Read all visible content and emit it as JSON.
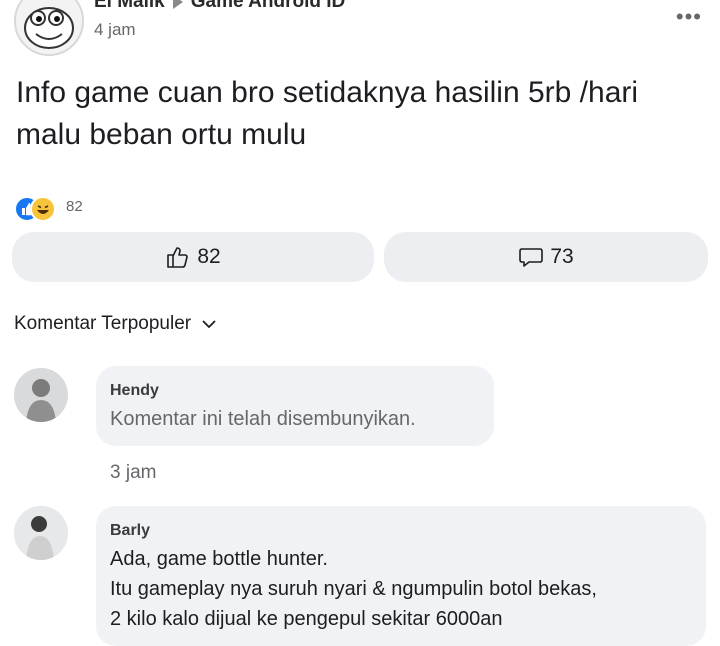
{
  "post": {
    "author": "El Malik",
    "group": "Game Android ID",
    "time": "4 jam",
    "text": "Info game cuan bro setidaknya hasilin 5rb /hari malu beban ortu mulu",
    "reaction_count": "82"
  },
  "actions": {
    "like_count": "82",
    "comment_count": "73"
  },
  "comments_section": {
    "sort_label": "Komentar Terpopuler"
  },
  "comments": [
    {
      "name": "Hendy",
      "text": "Komentar ini telah disembunyikan.",
      "time": "3 jam"
    },
    {
      "name": "Barly",
      "lines": [
        "Ada, game bottle hunter.",
        "Itu gameplay nya suruh nyari & ngumpulin botol bekas,",
        "2 kilo kalo dijual ke pengepul sekitar 6000an"
      ]
    }
  ],
  "colors": {
    "like_blue": "#1877f2",
    "haha_yellow": "#f7c33b",
    "bubble_gray": "#f0f2f5",
    "secondary_text": "#65676b"
  },
  "icons": [
    "cartoon-avatar-icon",
    "more-options-icon",
    "like-reaction-icon",
    "haha-reaction-icon",
    "thumbs-up-icon",
    "comment-icon",
    "chevron-down-icon"
  ]
}
